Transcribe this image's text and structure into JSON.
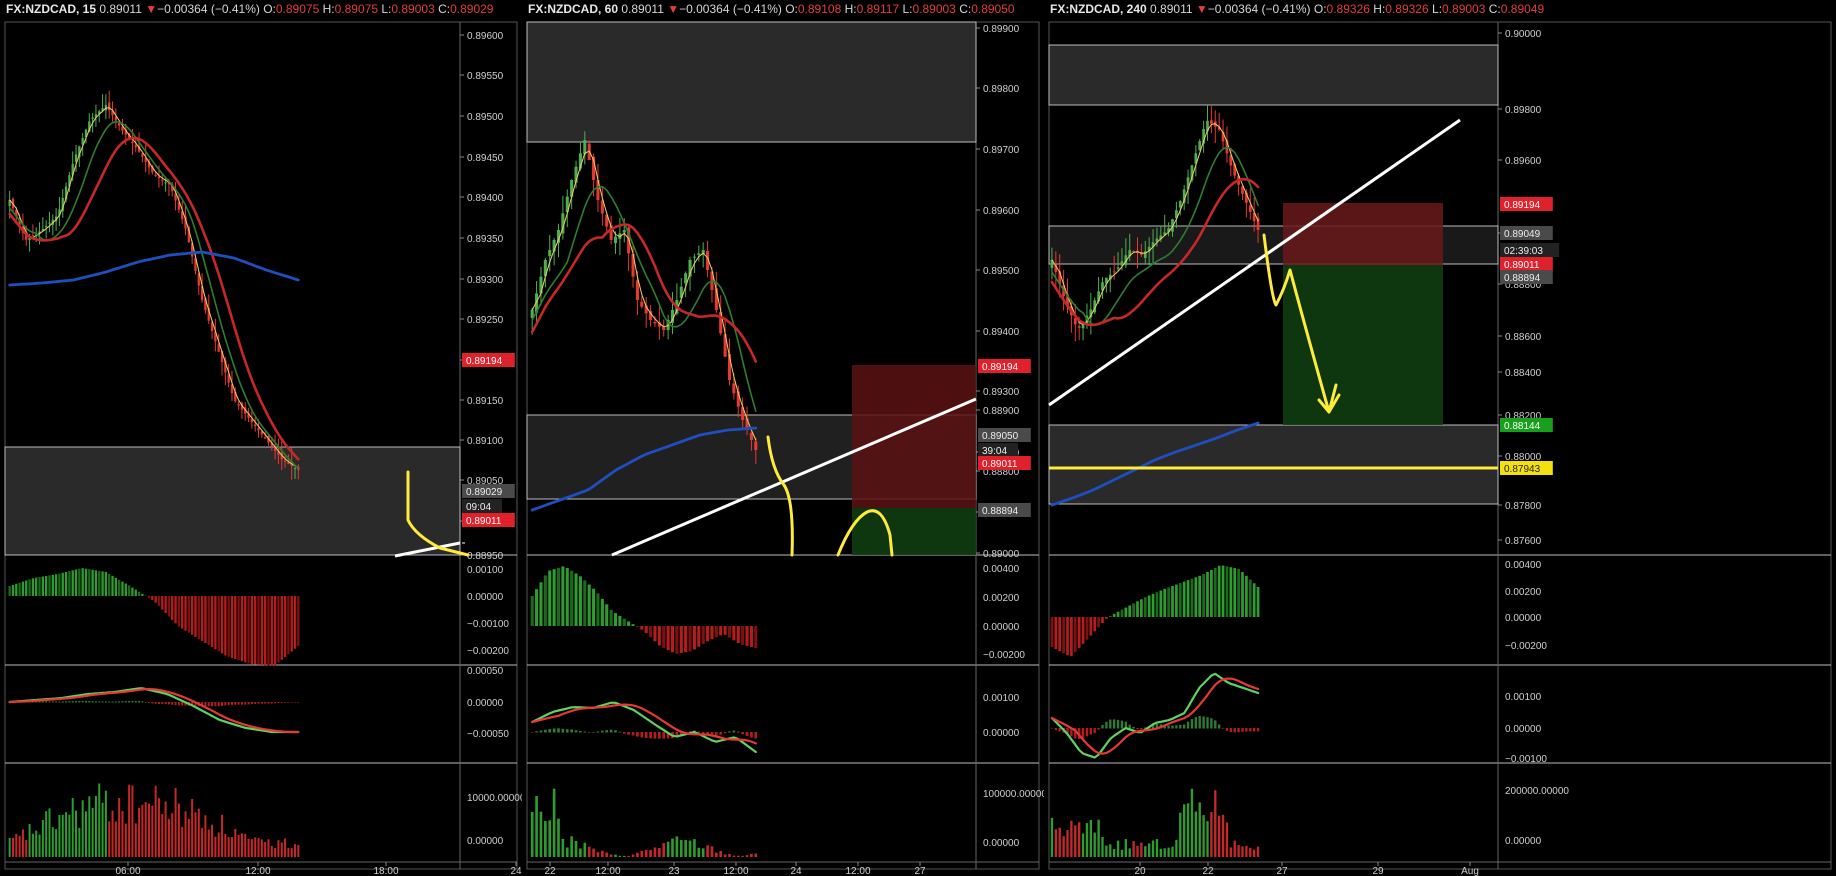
{
  "charts": [
    {
      "symbol": "FX:NZDCAD",
      "interval": "15",
      "price": "0.89011",
      "arrow": "▼",
      "change": "−0.00364 (−0.41%)",
      "open_label": "O:",
      "open": "0.89075",
      "high_label": "H:",
      "high": "0.89075",
      "low_label": "L:",
      "low": "0.89003",
      "close_label": "C:",
      "close": "0.89029",
      "price_ticks": [
        "0.89600",
        "0.89550",
        "0.89500",
        "0.89450",
        "0.89400",
        "0.89350",
        "0.89300",
        "0.89250",
        "0.89200",
        "0.89150",
        "0.89100",
        "0.89050",
        "0.89000",
        "0.88950"
      ],
      "price_badges": [
        {
          "text": "0.89194",
          "kind": "red"
        },
        {
          "text": "0.89029",
          "kind": "grey"
        },
        {
          "text": "09:04",
          "kind": "dark"
        },
        {
          "text": "0.89011",
          "kind": "red"
        }
      ],
      "osc1_ticks": [
        "0.00100",
        "0.00000",
        "−0.00100",
        "−0.00200"
      ],
      "macd_ticks": [
        "0.00050",
        "0.00000",
        "−0.00050"
      ],
      "vol_ticks": [
        "10000.00000",
        "0.00000"
      ],
      "time_ticks": [
        "06:00",
        "12:00",
        "18:00",
        "24"
      ]
    },
    {
      "symbol": "FX:NZDCAD",
      "interval": "60",
      "price": "0.89011",
      "arrow": "▼",
      "change": "−0.00364 (−0.41%)",
      "open_label": "O:",
      "open": "0.89108",
      "high_label": "H:",
      "high": "0.89117",
      "low_label": "L:",
      "low": "0.89003",
      "close_label": "C:",
      "close": "0.89050",
      "price_ticks": [
        "0.89900",
        "0.89800",
        "0.89700",
        "0.89600",
        "0.89500",
        "0.89400",
        "0.89300",
        "0.89200",
        "0.89100",
        "0.89000",
        "0.88900",
        "0.88800"
      ],
      "price_badges": [
        {
          "text": "0.89194",
          "kind": "red"
        },
        {
          "text": "0.89050",
          "kind": "grey"
        },
        {
          "text": "39:04",
          "kind": "dark"
        },
        {
          "text": "0.89011",
          "kind": "red"
        },
        {
          "text": "0.88894",
          "kind": "grey"
        }
      ],
      "osc1_ticks": [
        "0.00400",
        "0.00200",
        "0.00000",
        "−0.00200"
      ],
      "macd_ticks": [
        "0.00100",
        "0.00000"
      ],
      "vol_ticks": [
        "100000.00000",
        "0.00000"
      ],
      "time_ticks": [
        "22",
        "12:00",
        "23",
        "12:00",
        "24",
        "12:00",
        "27"
      ]
    },
    {
      "symbol": "FX:NZDCAD",
      "interval": "240",
      "price": "0.89011",
      "arrow": "▼",
      "change": "−0.00364 (−0.41%)",
      "open_label": "O:",
      "open": "0.89326",
      "high_label": "H:",
      "high": "0.89326",
      "low_label": "L:",
      "low": "0.89003",
      "close_label": "C:",
      "close": "0.89049",
      "price_ticks": [
        "0.90000",
        "0.89800",
        "0.89600",
        "0.89400",
        "0.88800",
        "0.88600",
        "0.88400",
        "0.88200",
        "0.88000",
        "0.87800",
        "0.87600"
      ],
      "price_badges": [
        {
          "text": "0.89194",
          "kind": "red"
        },
        {
          "text": "0.89049",
          "kind": "grey"
        },
        {
          "text": "02:39:03",
          "kind": "dark"
        },
        {
          "text": "0.89011",
          "kind": "red"
        },
        {
          "text": "0.88894",
          "kind": "grey"
        },
        {
          "text": "0.88144",
          "kind": "green"
        },
        {
          "text": "0.87943",
          "kind": "yellow"
        }
      ],
      "osc1_ticks": [
        "0.00400",
        "0.00200",
        "0.00000",
        "−0.00200"
      ],
      "macd_ticks": [
        "0.00100",
        "0.00000",
        "−0.00100"
      ],
      "vol_ticks": [
        "200000.00000",
        "0.00000"
      ],
      "time_ticks": [
        "20",
        "22",
        "27",
        "29",
        "Aug"
      ]
    }
  ],
  "colors": {
    "background": "#000000",
    "candle_up": "#4caf50",
    "candle_down": "#e53935",
    "ema_fast": "#f0d060",
    "ema_mid": "#2e7d32",
    "ema_slow": "#c62828",
    "ema_long": "#1e4fbf",
    "trendline": "#ffffff",
    "annotation": "#ffeb3b",
    "zone": "#3a3a3a",
    "stop_zone": "#7a1d1d",
    "target_zone": "#0f3d12",
    "badge_red": "#e0202a",
    "badge_green": "#17a01b",
    "badge_yellow": "#f4e00c",
    "badge_grey": "#4a4a4a"
  }
}
